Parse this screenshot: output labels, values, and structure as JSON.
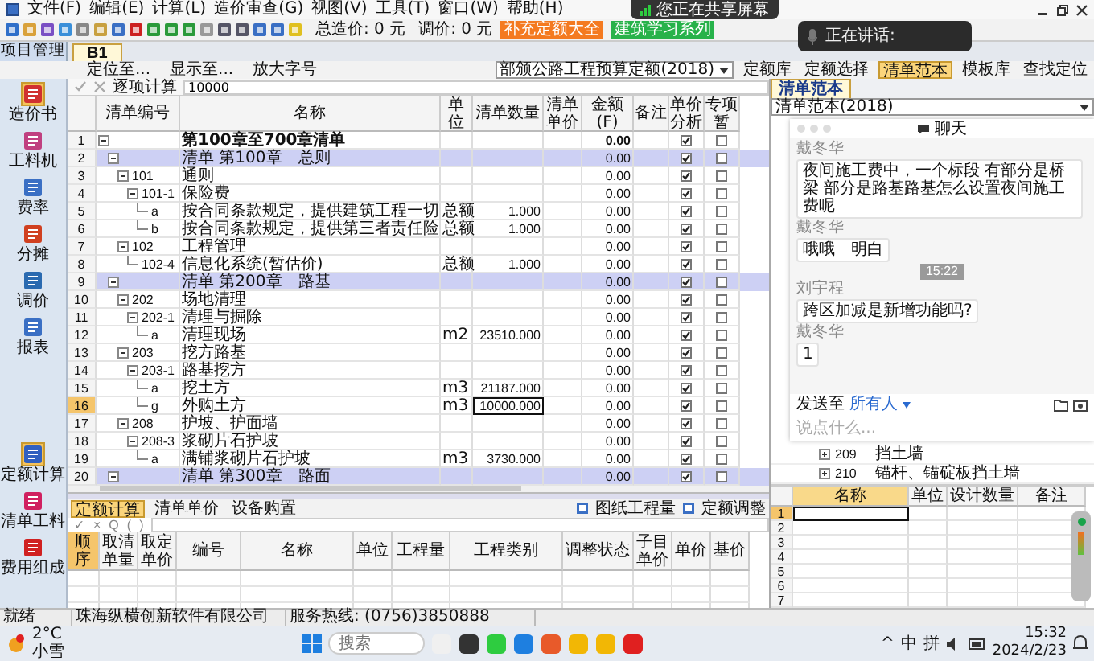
{
  "menu": [
    "文件(F)",
    "编辑(E)",
    "计算(L)",
    "造价审查(G)",
    "视图(V)",
    "工具(T)",
    "窗口(W)",
    "帮助(H)"
  ],
  "toolbar": {
    "total": "总造价: 0 元",
    "adjust": "调价: 0 元",
    "promo_buttons": [
      {
        "label": "补充定额大全",
        "color": "#f47a20"
      },
      {
        "label": "建筑学习系列",
        "color": "#27b24a"
      }
    ]
  },
  "screen_share": {
    "text": "您正在共享屏幕"
  },
  "speaking": {
    "text": "正在讲话:"
  },
  "project_tab": "项目管理",
  "doc_tabs": [
    {
      "label": "B1",
      "selected": true
    }
  ],
  "library": {
    "value": "部颁公路工程预算定额(2018)",
    "buttons": [
      {
        "label": "定额库",
        "selected": false
      },
      {
        "label": "定额选择",
        "selected": false
      },
      {
        "label": "清单范本",
        "selected": true
      },
      {
        "label": "模板库",
        "selected": false
      },
      {
        "label": "查找定位",
        "selected": false
      }
    ]
  },
  "find_bar": [
    "定位至...",
    "显示至...",
    "放大字号"
  ],
  "edit_bar": {
    "label": "逐项计算",
    "value": "10000"
  },
  "sidebar": {
    "top": [
      {
        "label": "造价书",
        "selected": true
      },
      {
        "label": "工料机",
        "selected": false
      },
      {
        "label": "费率",
        "selected": false
      },
      {
        "label": "分摊",
        "selected": false
      },
      {
        "label": "调价",
        "selected": false
      },
      {
        "label": "报表",
        "selected": false
      }
    ],
    "bottom": [
      {
        "label": "定额计算",
        "selected": true
      },
      {
        "label": "清单工料",
        "selected": false
      },
      {
        "label": "费用组成",
        "selected": false
      }
    ]
  },
  "table": {
    "columns": [
      "",
      "清单编号",
      "名称",
      "单位",
      "清单数量",
      "清单单价",
      "金额 (F)",
      "备注",
      "单价分析",
      "专项暂"
    ],
    "rows": [
      {
        "num": "1",
        "kind": "total",
        "expanded": true,
        "name": "第100章至700章清单",
        "amount": "0.00",
        "analysis": true,
        "special": false,
        "selected": false,
        "children": [
          {
            "num": "2",
            "kind": "section",
            "expanded": true,
            "name": "清单 第100章　总则",
            "amount": "0.00",
            "analysis": true,
            "special": false,
            "selected": false,
            "children": [
              {
                "num": "3",
                "kind": "item",
                "code": "101",
                "expanded": true,
                "name": "通则",
                "amount": "0.00",
                "analysis": true,
                "special": false,
                "selected": false,
                "children": [
                  {
                    "num": "4",
                    "kind": "item",
                    "code": "101-1",
                    "expanded": true,
                    "name": "保险费",
                    "amount": "0.00",
                    "analysis": true,
                    "special": false,
                    "selected": false,
                    "children": [
                      {
                        "num": "5",
                        "kind": "item",
                        "code": "a",
                        "name": "按合同条款规定，提供建筑工程一切",
                        "unit": "总额",
                        "qty": "1.000",
                        "amount": "0.00",
                        "analysis": true,
                        "special": false,
                        "selected": false
                      },
                      {
                        "num": "6",
                        "kind": "item",
                        "code": "b",
                        "name": "按合同条款规定，提供第三者责任险",
                        "unit": "总额",
                        "qty": "1.000",
                        "amount": "0.00",
                        "analysis": true,
                        "special": false,
                        "selected": false
                      }
                    ]
                  }
                ]
              },
              {
                "num": "7",
                "kind": "item",
                "code": "102",
                "expanded": true,
                "name": "工程管理",
                "amount": "0.00",
                "analysis": true,
                "special": false,
                "selected": false,
                "children": [
                  {
                    "num": "8",
                    "kind": "item",
                    "code": "102-4",
                    "name": "信息化系统(暂估价)",
                    "unit": "总额",
                    "qty": "1.000",
                    "amount": "0.00",
                    "analysis": true,
                    "special": false,
                    "selected": false
                  }
                ]
              }
            ]
          },
          {
            "num": "9",
            "kind": "section",
            "expanded": true,
            "name": "清单 第200章　路基",
            "amount": "0.00",
            "analysis": true,
            "special": false,
            "selected": false,
            "children": [
              {
                "num": "10",
                "kind": "item",
                "code": "202",
                "expanded": true,
                "name": "场地清理",
                "amount": "0.00",
                "analysis": true,
                "special": false,
                "selected": false,
                "children": [
                  {
                    "num": "11",
                    "kind": "item",
                    "code": "202-1",
                    "expanded": true,
                    "name": "清理与掘除",
                    "amount": "0.00",
                    "analysis": true,
                    "special": false,
                    "selected": false,
                    "children": [
                      {
                        "num": "12",
                        "kind": "item",
                        "code": "a",
                        "name": "清理现场",
                        "unit": "m2",
                        "qty": "23510.000",
                        "amount": "0.00",
                        "analysis": true,
                        "special": false,
                        "selected": false
                      }
                    ]
                  }
                ]
              },
              {
                "num": "13",
                "kind": "item",
                "code": "203",
                "expanded": true,
                "name": "挖方路基",
                "amount": "0.00",
                "analysis": true,
                "special": false,
                "selected": false,
                "children": [
                  {
                    "num": "14",
                    "kind": "item",
                    "code": "203-1",
                    "expanded": true,
                    "name": "路基挖方",
                    "amount": "0.00",
                    "analysis": true,
                    "special": false,
                    "selected": false,
                    "children": [
                      {
                        "num": "15",
                        "kind": "item",
                        "code": "a",
                        "name": "挖土方",
                        "unit": "m3",
                        "qty": "21187.000",
                        "amount": "0.00",
                        "analysis": true,
                        "special": false,
                        "selected": false
                      },
                      {
                        "num": "16",
                        "kind": "item",
                        "code": "g",
                        "name": "外购土方",
                        "unit": "m3",
                        "qty": "10000.000",
                        "amount": "0.00",
                        "analysis": true,
                        "special": false,
                        "selected": true
                      }
                    ]
                  }
                ]
              },
              {
                "num": "17",
                "kind": "item",
                "code": "208",
                "expanded": true,
                "name": "护坡、护面墙",
                "amount": "0.00",
                "analysis": true,
                "special": false,
                "selected": false,
                "children": [
                  {
                    "num": "18",
                    "kind": "item",
                    "code": "208-3",
                    "expanded": true,
                    "name": "浆砌片石护坡",
                    "amount": "0.00",
                    "analysis": true,
                    "special": false,
                    "selected": false,
                    "children": [
                      {
                        "num": "19",
                        "kind": "item",
                        "code": "a",
                        "name": "满铺浆砌片石护坡",
                        "unit": "m3",
                        "qty": "3730.000",
                        "amount": "0.00",
                        "analysis": true,
                        "special": false,
                        "selected": false
                      }
                    ]
                  }
                ]
              }
            ]
          },
          {
            "num": "20",
            "kind": "section",
            "expanded": true,
            "name": "清单 第300章　路面",
            "amount": "0.00",
            "analysis": true,
            "special": false,
            "selected": false
          }
        ]
      }
    ]
  },
  "lower": {
    "tabs": [
      {
        "label": "定额计算",
        "selected": true
      },
      {
        "label": "清单单价",
        "selected": false
      },
      {
        "label": "设备购置",
        "selected": false
      }
    ],
    "buttons": [
      "图纸工程量",
      "定额调整"
    ],
    "edit_symbols": [
      "✓",
      "×",
      "Q",
      "(",
      ")"
    ],
    "columns": [
      "顺序",
      "取清单量",
      "取定单价",
      "编号",
      "名称",
      "单位",
      "工程量",
      "工程类别",
      "调整状态",
      "子目单价",
      "单价",
      "基价"
    ]
  },
  "right_panel": {
    "tab": "清单范本",
    "combo": "清单范本(2018)",
    "tree": [
      {
        "code": "209",
        "expanded": false,
        "name": "挡土墙"
      },
      {
        "code": "210",
        "expanded": false,
        "name": "锚杆、锚碇板挡土墙"
      }
    ],
    "columns": [
      "名称",
      "单位",
      "设计数量",
      "备注"
    ],
    "rows": [
      {
        "num": "1",
        "selected": true
      },
      {
        "num": "2",
        "selected": false
      },
      {
        "num": "3",
        "selected": false
      },
      {
        "num": "4",
        "selected": false
      },
      {
        "num": "5",
        "selected": false
      },
      {
        "num": "6",
        "selected": false
      },
      {
        "num": "7",
        "selected": false
      }
    ]
  },
  "chat": {
    "title": "聊天",
    "messages": [
      {
        "kind": "message",
        "sender": "戴冬华",
        "text": "夜间施工费中，一个标段 有部分是桥梁 部分是路基路基怎么设置夜间施工费呢"
      },
      {
        "kind": "message",
        "sender": "戴冬华",
        "text": "哦哦　明白"
      },
      {
        "kind": "time",
        "text": "15:22"
      },
      {
        "kind": "message",
        "sender": "刘宇程",
        "text": "跨区加减是新增功能吗?"
      },
      {
        "kind": "message",
        "sender": "戴冬华",
        "text": "1"
      }
    ],
    "send_label": "发送至",
    "send_target": "所有人",
    "placeholder": "说点什么..."
  },
  "status_bar": [
    "就绪",
    "珠海纵横创新软件有限公司",
    "服务热线: (0756)3850888"
  ],
  "taskbar": {
    "temp": "2°C",
    "weather": "小雪",
    "search_placeholder": "搜索",
    "tray": [
      "^",
      "中",
      "拼"
    ],
    "time": "15:32",
    "date": "2024/2/23"
  }
}
